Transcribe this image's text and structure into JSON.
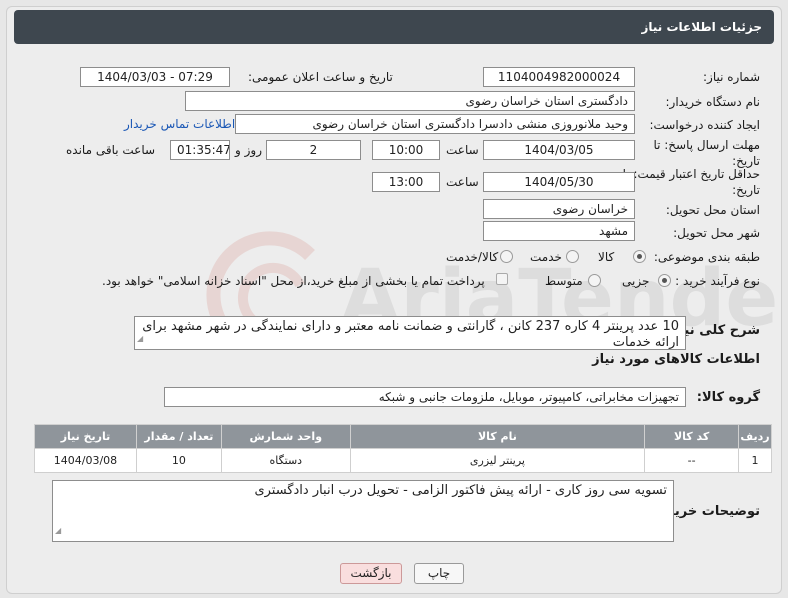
{
  "header": {
    "title": "جزئیات اطلاعات نیاز"
  },
  "form": {
    "need_number_label": "شماره نیاز:",
    "need_number": "1104004982000024",
    "announce_datetime_label": "تاریخ و ساعت اعلان عمومی:",
    "announce_datetime": "1404/03/03 - 07:29",
    "buyer_org_label": "نام دستگاه خریدار:",
    "buyer_org": "دادگستری استان خراسان رضوی",
    "requester_label": "ایجاد کننده درخواست:",
    "requester": "وحید ملانوروزی منشی دادسرا دادگستری استان خراسان رضوی",
    "buyer_contact_link": "اطلاعات تماس خریدار",
    "reply_deadline_label": "مهلت ارسال پاسخ: تا تاریخ:",
    "reply_date": "1404/03/05",
    "hour_label": "ساعت",
    "reply_time": "10:00",
    "days_value": "2",
    "day_and_label": "روز و",
    "remaining_time": "01:35:47",
    "remaining_label": "ساعت باقی مانده",
    "price_validity_label": "حداقل تاریخ اعتبار قیمت: تا تاریخ:",
    "price_validity_date": "1404/05/30",
    "price_validity_hour_label": "ساعت",
    "price_validity_time": "13:00",
    "delivery_province_label": "استان محل تحویل:",
    "delivery_province": "خراسان رضوی",
    "delivery_city_label": "شهر محل تحویل:",
    "delivery_city": "مشهد",
    "category_label": "طبقه بندی موضوعی:",
    "category_options": [
      "کالا",
      "خدمت",
      "کالا/خدمت"
    ],
    "category_selected": "کالا",
    "process_label": "نوع فرآیند خرید :",
    "process_options": [
      "جزیی",
      "متوسط"
    ],
    "process_selected": "جزیی",
    "payment_note": "پرداخت تمام یا بخشی از مبلغ خرید،از محل \"اسناد خزانه اسلامی\" خواهد بود."
  },
  "description": {
    "label": "شرح کلی نیاز:",
    "text": "10 عدد پرینتر 4 کاره 237 کانن ، گارانتی و ضمانت نامه معتبر و دارای نمایندگی در شهر مشهد برای ارائه خدمات"
  },
  "goods": {
    "section_title": "اطلاعات کالاهای مورد نیاز",
    "group_label": "گروه کالا:",
    "group_value": "تجهیزات مخابراتی، کامپیوتر، موبایل، ملزومات جانبی و شبکه",
    "table": {
      "headers": [
        "ردیف",
        "کد کالا",
        "نام کالا",
        "واحد شمارش",
        "تعداد / مقدار",
        "تاریخ نیاز"
      ],
      "rows": [
        [
          "1",
          "--",
          "پرینتر لیزری",
          "دستگاه",
          "10",
          "1404/03/08"
        ]
      ]
    }
  },
  "buyer_notes": {
    "label": "توضیحات خریدار:",
    "text": "تسویه سی روز کاری - ارائه پیش فاکتور الزامی - تحویل درب انبار دادگستری"
  },
  "buttons": {
    "print": "چاپ",
    "back": "بازگشت"
  },
  "watermark": {
    "text": "AriaTender.neT"
  },
  "colors": {
    "header_bg": "#3e474f",
    "table_header_bg": "#8f959b",
    "link": "#1a57b5",
    "back_button_bg": "#f9dede"
  }
}
